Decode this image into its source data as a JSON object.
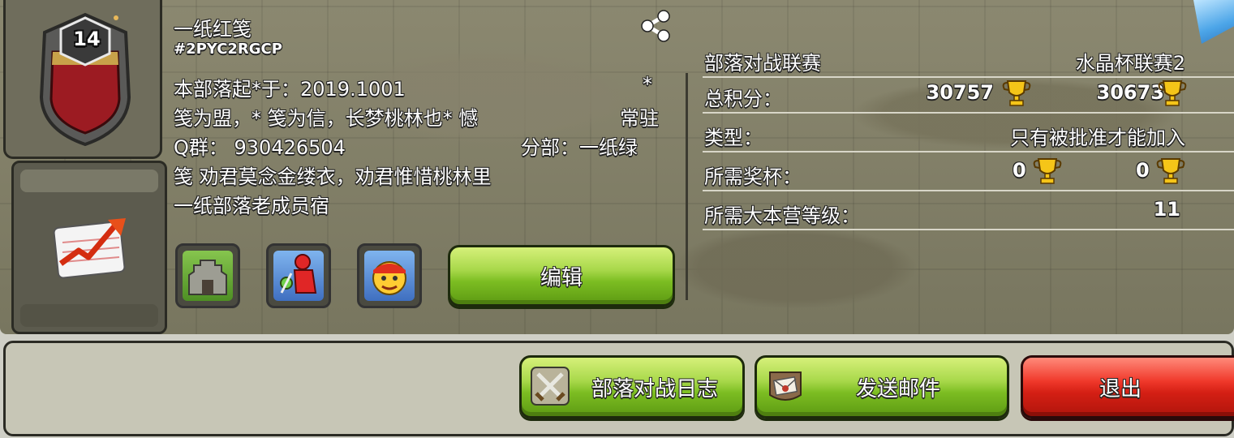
{
  "clan": {
    "level": "14",
    "name": "一纸红笺",
    "tag": "#2PYC2RGCP",
    "description_lines": [
      "本部落起*于：2019.1001",
      "笺为盟，* 笺为信，长梦桃林也* 憾",
      "Q群： 930426504",
      "笺 劝君莫念金缕衣，劝君惟惜桃林里",
      "一纸部落老成员宿"
    ],
    "description_right": [
      "*",
      "常驻",
      "分部：一纸绿"
    ]
  },
  "actions": {
    "edit_label": "编辑",
    "war_log_label": "部落对战日志",
    "send_mail_label": "发送邮件",
    "leave_label": "退出"
  },
  "info": {
    "war_league_label": "部落对战联赛",
    "war_league_value": "水晶杯联赛2",
    "total_points_label": "总积分：",
    "total_points_trophies": "30757",
    "total_points_versus": "30673",
    "type_label": "类型：",
    "type_value": "只有被批准才能加入",
    "required_trophies_label": "所需奖杯：",
    "required_trophies": "0",
    "required_versus_trophies": "0",
    "required_th_label": "所需大本营等级：",
    "required_th_value": "11"
  },
  "icons": {
    "share": "share-icon",
    "stats": "stats-chart-icon",
    "capital": "clan-capital-icon",
    "war": "war-frequency-icon",
    "friendly": "friendly-icon",
    "trophy": "trophy-icon",
    "versus_trophy": "versus-trophy-icon",
    "war_log": "crossed-swords-icon",
    "mail": "mail-icon"
  },
  "colors": {
    "green_button": "#7cbd22",
    "red_button": "#d41f14",
    "badge_red": "#9c1b22"
  }
}
